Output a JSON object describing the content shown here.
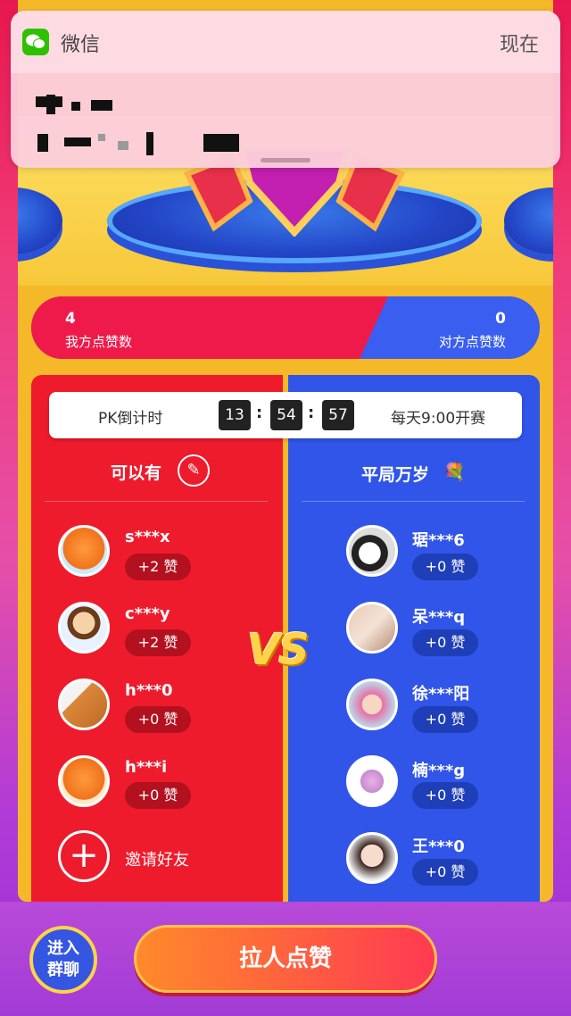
{
  "notification": {
    "app_name": "微信",
    "time": "现在"
  },
  "score": {
    "ours_value": "4",
    "ours_label": "我方点赞数",
    "theirs_value": "0",
    "theirs_label": "对方点赞数"
  },
  "timer": {
    "label": "PK倒计时",
    "hours": "13",
    "minutes": "54",
    "seconds": "57",
    "sep": ":",
    "note": "每天9:00开赛"
  },
  "left_team": {
    "name": "可以有",
    "members": [
      {
        "name": "s***x",
        "likes": "+2 赞",
        "avatar": "orange-mascot"
      },
      {
        "name": "c***y",
        "likes": "+2 赞",
        "avatar": "cartoon-girl"
      },
      {
        "name": "h***0",
        "likes": "+0 赞",
        "avatar": "orange-animal"
      },
      {
        "name": "h***i",
        "likes": "+0 赞",
        "avatar": "orange-mascot"
      }
    ],
    "invite_label": "邀请好友"
  },
  "right_team": {
    "name": "平局万岁",
    "members": [
      {
        "name": "琚***6",
        "likes": "+0 赞",
        "avatar": "cat"
      },
      {
        "name": "呆***q",
        "likes": "+0 赞",
        "avatar": "photo"
      },
      {
        "name": "徐***阳",
        "likes": "+0 赞",
        "avatar": "child"
      },
      {
        "name": "楠***g",
        "likes": "+0 赞",
        "avatar": "cartoon"
      },
      {
        "name": "王***0",
        "likes": "+0 赞",
        "avatar": "girl"
      }
    ]
  },
  "vs": "VS",
  "bottom": {
    "group_line1": "进入",
    "group_line2": "群聊",
    "cta": "拉人点赞"
  },
  "colors": {
    "red_team": "#ee1b2c",
    "blue_team": "#3055e8",
    "frame": "#f5b829"
  }
}
